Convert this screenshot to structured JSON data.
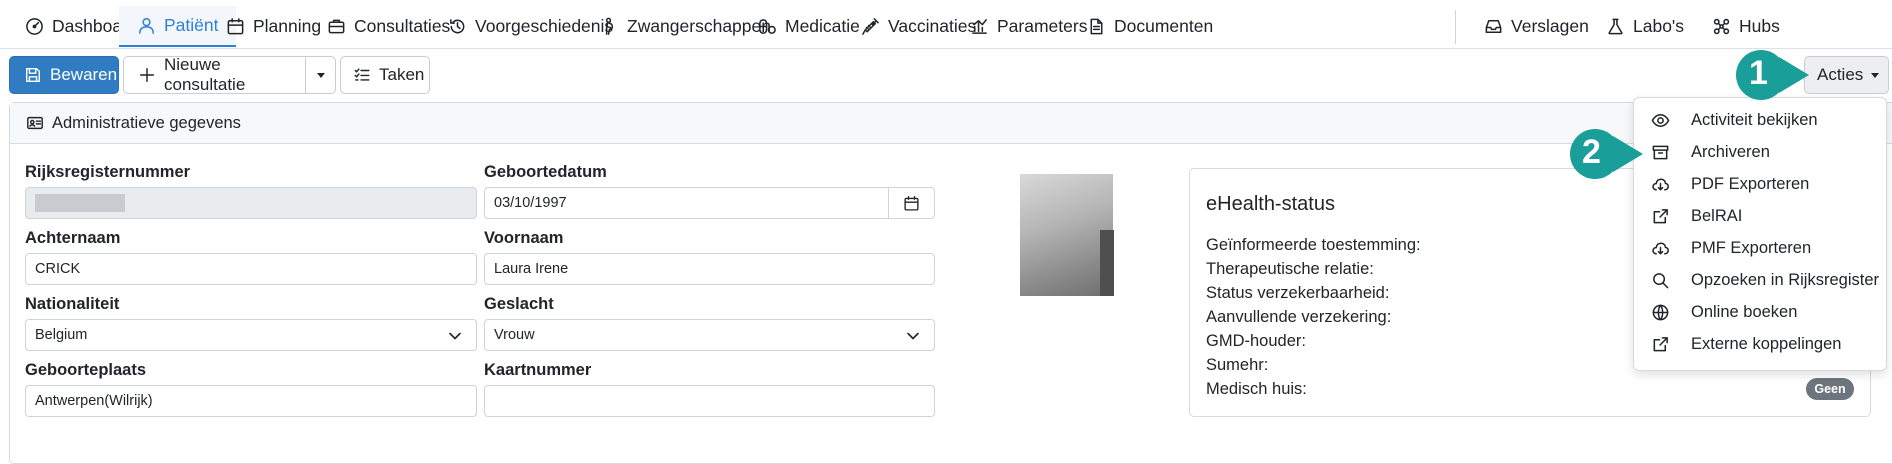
{
  "tabs": [
    {
      "label": "Dashboard",
      "icon": "dashboard-gauge-icon"
    },
    {
      "label": "Patiënt",
      "icon": "person-icon",
      "active": true
    },
    {
      "label": "Planning",
      "icon": "calendar-icon"
    },
    {
      "label": "Consultaties",
      "icon": "briefcase-icon"
    },
    {
      "label": "Voorgeschiedenis",
      "icon": "history-icon"
    },
    {
      "label": "Zwangerschappen",
      "icon": "pregnancy-icon"
    },
    {
      "label": "Medicatie",
      "icon": "pills-icon"
    },
    {
      "label": "Vaccinaties",
      "icon": "syringe-icon"
    },
    {
      "label": "Parameters",
      "icon": "chart-icon"
    },
    {
      "label": "Documenten",
      "icon": "document-icon"
    },
    {
      "label": "Verslagen",
      "icon": "inbox-icon"
    },
    {
      "label": "Labo's",
      "icon": "flask-icon"
    },
    {
      "label": "Hubs",
      "icon": "hubs-icon"
    }
  ],
  "toolbar": {
    "save_label": "Bewaren",
    "new_consult_label": "Nieuwe consultatie",
    "tasks_label": "Taken",
    "actions_label": "Acties"
  },
  "card": {
    "header": "Administratieve gegevens",
    "fields": {
      "rijksregister": {
        "label": "Rijksregisternummer",
        "value": ""
      },
      "geboortedatum": {
        "label": "Geboortedatum",
        "value": "03/10/1997"
      },
      "achternaam": {
        "label": "Achternaam",
        "value": "CRICK"
      },
      "voornaam": {
        "label": "Voornaam",
        "value": "Laura Irene"
      },
      "nationaliteit": {
        "label": "Nationaliteit",
        "value": "Belgium"
      },
      "geslacht": {
        "label": "Geslacht",
        "value": "Vrouw"
      },
      "geboorteplaats": {
        "label": "Geboorteplaats",
        "value": "Antwerpen(Wilrijk)"
      },
      "kaartnummer": {
        "label": "Kaartnummer",
        "value": ""
      }
    }
  },
  "ehealth": {
    "title": "eHealth-status",
    "rows": [
      "Geïnformeerde toestemming:",
      "Therapeutische relatie:",
      "Status verzekerbaarheid:",
      "Aanvullende verzekering:",
      "GMD-houder:",
      "Sumehr:",
      "Medisch huis:"
    ],
    "badge": "Geen"
  },
  "dropdown": [
    {
      "label": "Activiteit bekijken",
      "icon": "eye-icon"
    },
    {
      "label": "Archiveren",
      "icon": "archive-icon"
    },
    {
      "label": "PDF Exporteren",
      "icon": "cloud-download-icon"
    },
    {
      "label": "BelRAI",
      "icon": "external-link-icon"
    },
    {
      "label": "PMF Exporteren",
      "icon": "cloud-download-icon"
    },
    {
      "label": "Opzoeken in Rijksregister",
      "icon": "search-icon"
    },
    {
      "label": "Online boeken",
      "icon": "globe-icon"
    },
    {
      "label": "Externe koppelingen",
      "icon": "external-link-icon"
    }
  ],
  "callouts": {
    "first": "1",
    "second": "2"
  },
  "colors": {
    "accent": "#2f80d6",
    "primary_button": "#2f7cc2",
    "callout": "#1a9e9a",
    "badge": "#6c757d"
  }
}
